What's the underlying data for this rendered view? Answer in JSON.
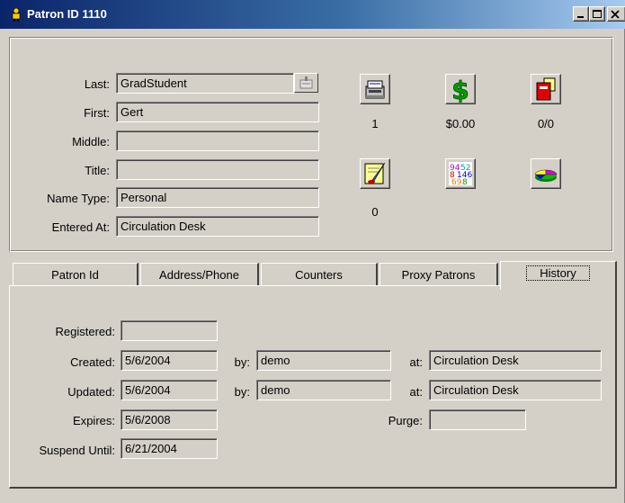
{
  "window": {
    "title": "Patron ID 1110",
    "controls": {
      "minimize": "minimize",
      "maximize": "maximize",
      "close": "close"
    }
  },
  "patron": {
    "labels": {
      "last": "Last:",
      "first": "First:",
      "middle": "Middle:",
      "title": "Title:",
      "name_type": "Name Type:",
      "entered_at": "Entered At:"
    },
    "values": {
      "last": "GradStudent",
      "first": "Gert",
      "middle": "",
      "title": "",
      "name_type": "Personal",
      "entered_at": "Circulation Desk"
    }
  },
  "summary_icons": [
    {
      "icon": "card-file-icon",
      "count": "1"
    },
    {
      "icon": "dollar-sign-icon",
      "count": "$0.00"
    },
    {
      "icon": "red-book-icon",
      "count": "0/0"
    },
    {
      "icon": "note-quill-icon",
      "count": "0"
    },
    {
      "icon": "numbers-grid-icon",
      "count": ""
    },
    {
      "icon": "pie-chart-icon",
      "count": ""
    }
  ],
  "tabs": [
    {
      "label": "Patron Id",
      "active": false
    },
    {
      "label": "Address/Phone",
      "active": false
    },
    {
      "label": "Counters",
      "active": false
    },
    {
      "label": "Proxy Patrons",
      "active": false
    },
    {
      "label": "History",
      "active": true
    }
  ],
  "history": {
    "labels": {
      "registered": "Registered:",
      "created": "Created:",
      "updated": "Updated:",
      "expires": "Expires:",
      "suspend_until": "Suspend Until:",
      "by": "by:",
      "at": "at:",
      "purge": "Purge:"
    },
    "values": {
      "registered": "",
      "created_date": "5/6/2004",
      "created_by": "demo",
      "created_at": "Circulation Desk",
      "updated_date": "5/6/2004",
      "updated_by": "demo",
      "updated_at": "Circulation Desk",
      "expires": "5/6/2008",
      "purge": "",
      "suspend_until": "6/21/2004"
    }
  }
}
